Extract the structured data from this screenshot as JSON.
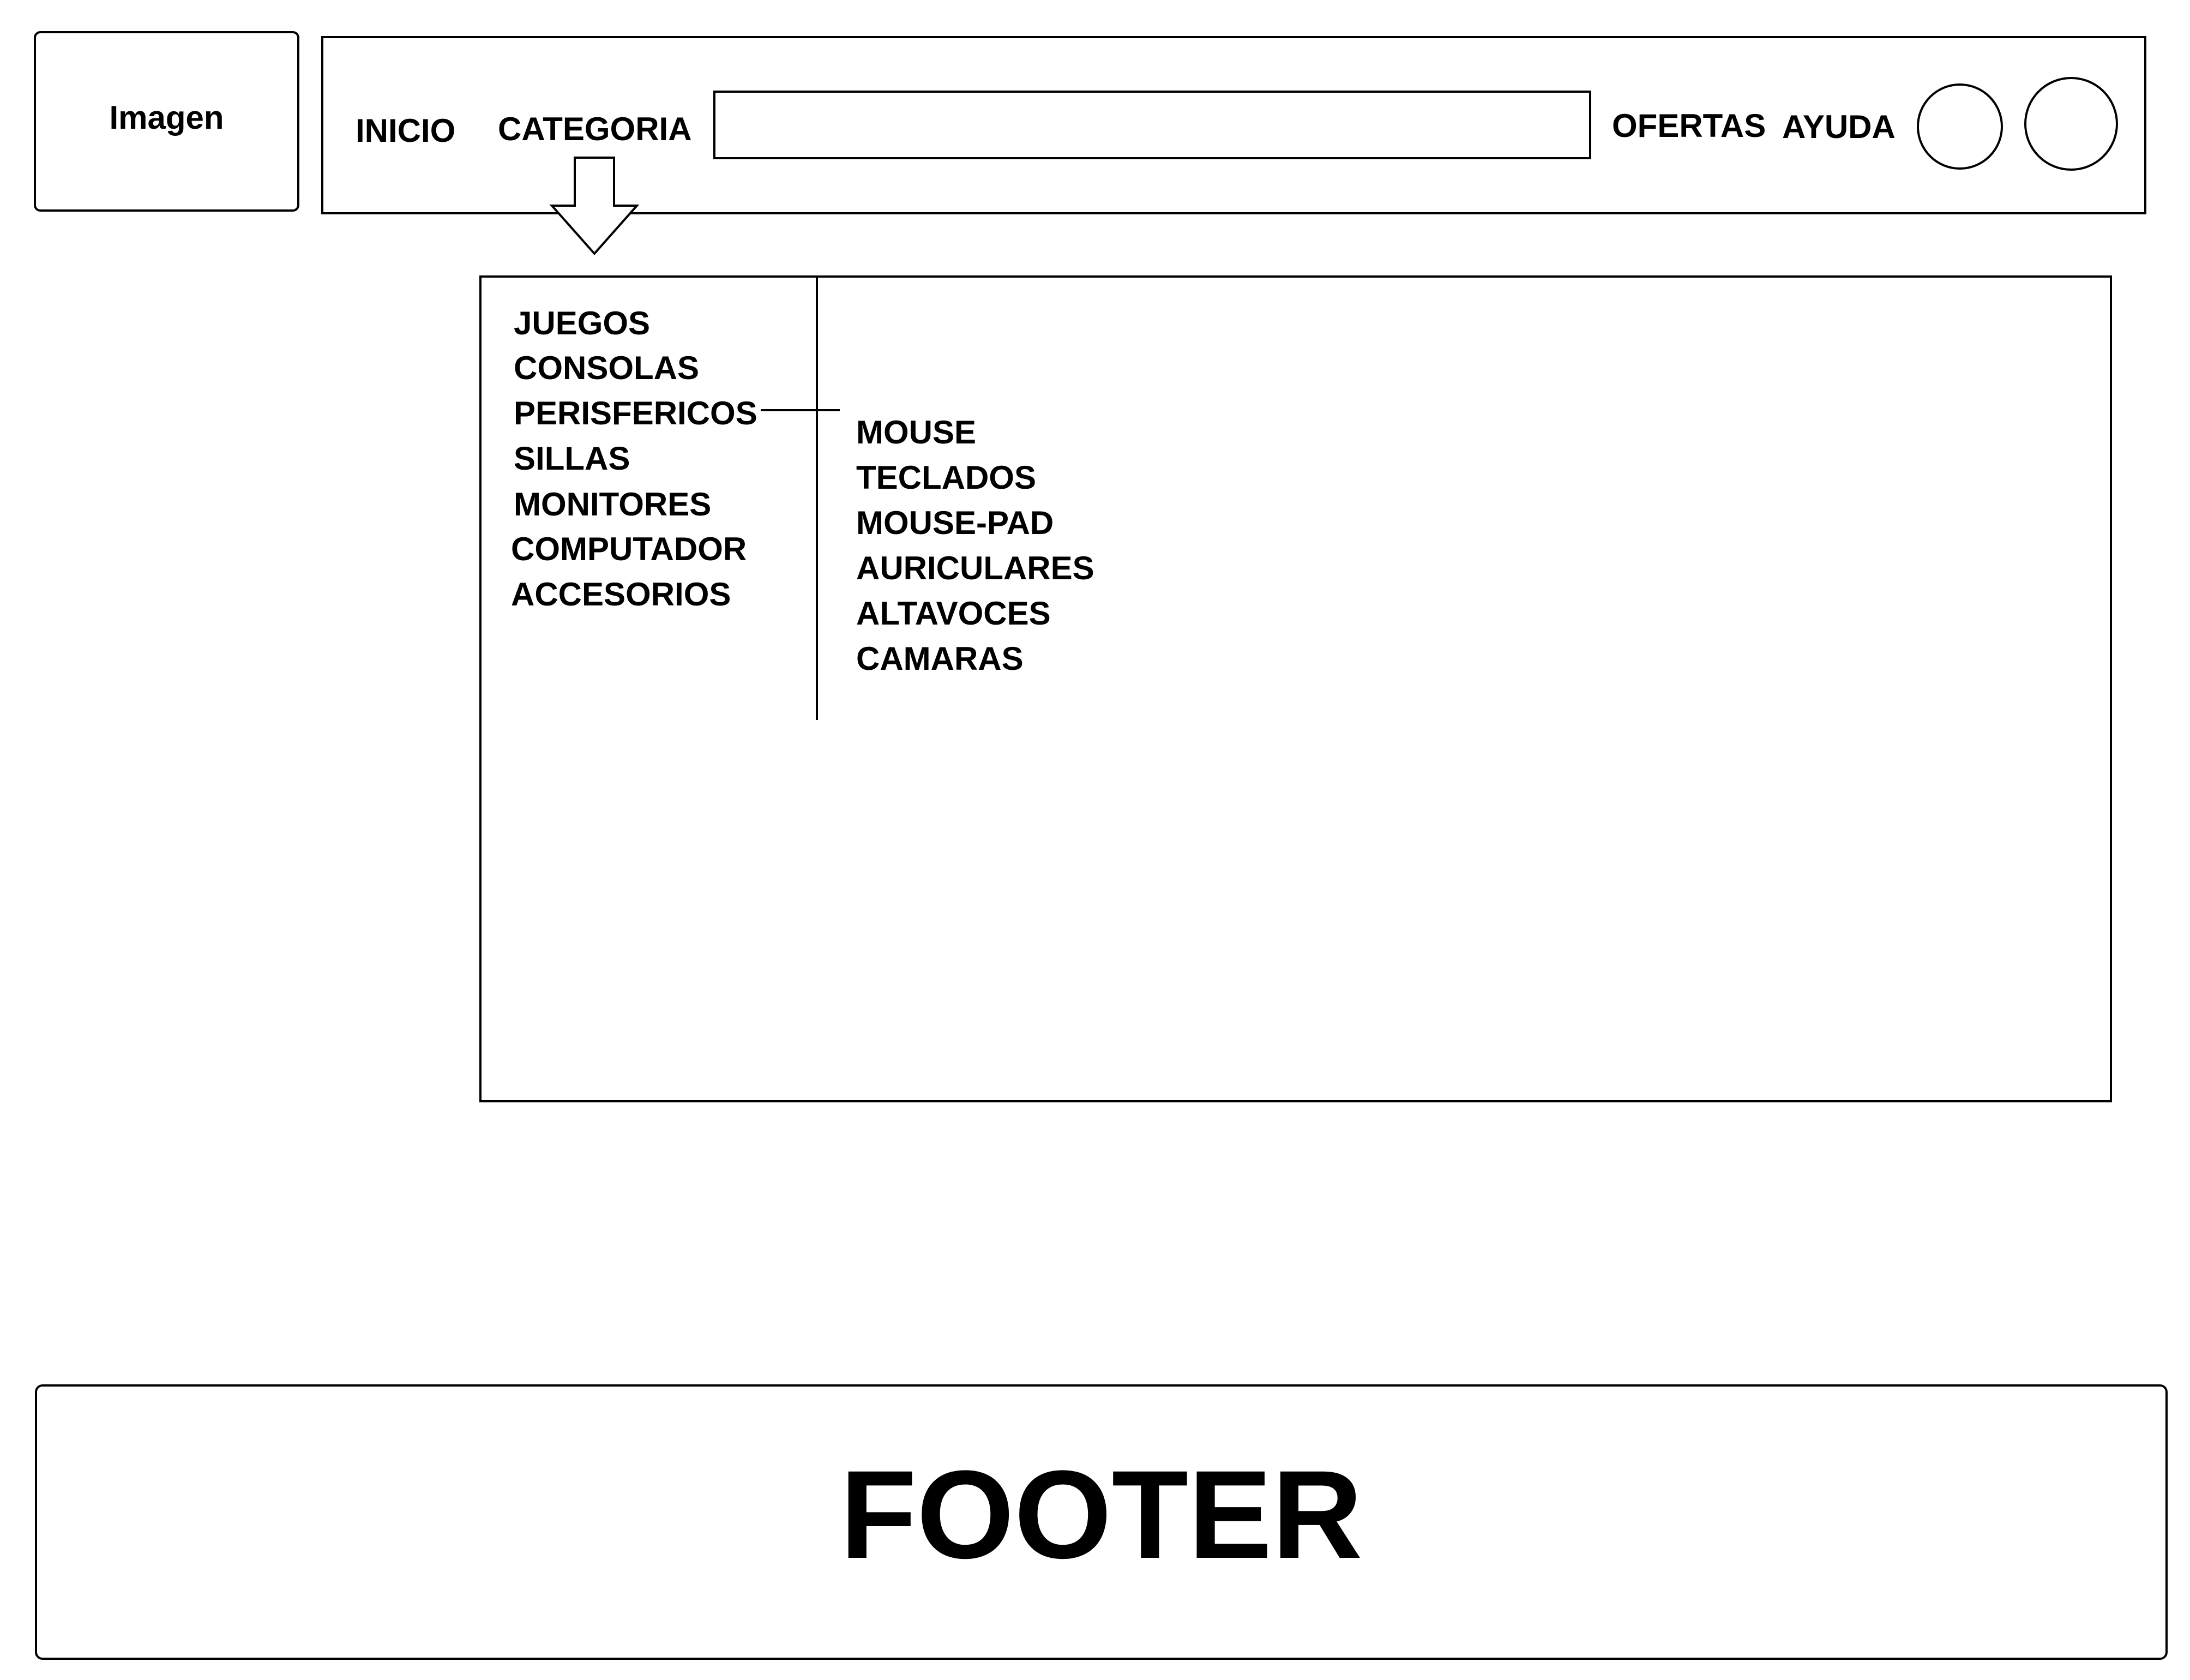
{
  "logo": {
    "label": "Imagen"
  },
  "nav": {
    "inicio": "INICIO",
    "categoria": "CATEGORIA",
    "ofertas": "OFERTAS",
    "ayuda": "AYUDA"
  },
  "categories": [
    "JUEGOS",
    "CONSOLAS",
    "PERISFERICOS",
    "SILLAS",
    "MONITORES",
    "COMPUTADOR",
    "ACCESORIOS"
  ],
  "subcategories": [
    "MOUSE",
    "TECLADOS",
    "MOUSE-PAD",
    "AURICULARES",
    "ALTAVOCES",
    "CAMARAS"
  ],
  "footer": {
    "label": "FOOTER"
  }
}
